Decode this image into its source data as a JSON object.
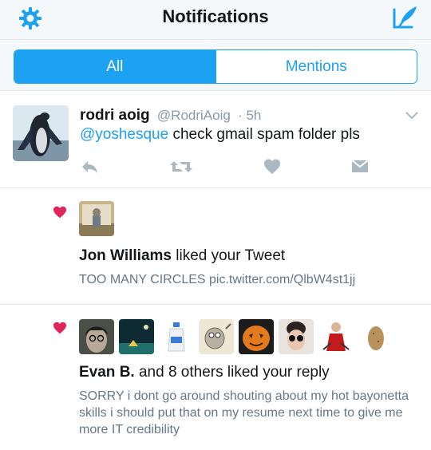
{
  "header": {
    "title": "Notifications",
    "settings_icon": "gear-icon",
    "compose_icon": "compose-icon",
    "accent": "#1da1f2"
  },
  "tabs": [
    {
      "label": "All",
      "active": true
    },
    {
      "label": "Mentions",
      "active": false
    }
  ],
  "tweet": {
    "name": "rodri aoig",
    "handle": "@RodriAoig",
    "time": "· 5h",
    "mention": "@yoshesque",
    "text": " check gmail spam folder pls",
    "actions": [
      "reply-icon",
      "retweet-icon",
      "like-icon",
      "direct-message-icon"
    ]
  },
  "notifications": [
    {
      "icon": "heart-icon",
      "liker": "Jon Williams",
      "action": " liked your Tweet",
      "quoted": "TOO MANY CIRCLES pic.twitter.com/QlbW4st1jj"
    },
    {
      "icon": "heart-icon",
      "liker": "Evan B.",
      "action": " and 8 others liked your reply",
      "quoted": "SORRY i dont go around shouting about my hot bayonetta skills i should put that on my resume next time to give me more IT credibility"
    }
  ]
}
